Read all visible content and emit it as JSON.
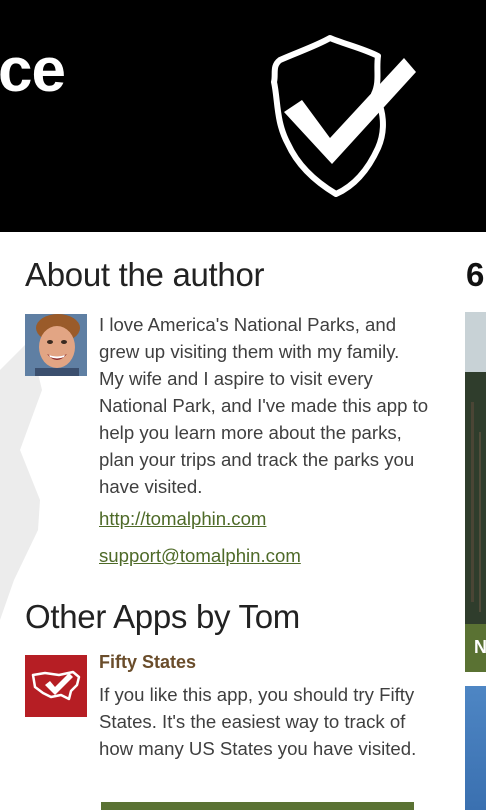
{
  "header": {
    "title_fragment": "ce",
    "logo_icon": "arrowhead-check-icon"
  },
  "about": {
    "title": "About the author",
    "avatar_icon": "author-avatar",
    "bio": "I love America's National Parks, and grew up visiting them with my family. My wife and I aspire to visit every National Park, and I've made this app to help you learn more about the parks, plan your trips and track the parks you have visited.",
    "website": "http://tomalphin.com",
    "email": "support@tomalphin.com"
  },
  "other_apps": {
    "title": "Other Apps by Tom",
    "apps": [
      {
        "name": "Fifty States",
        "description": "If you like this app, you should try Fifty States. It's the easiest way to track of how many US States you have visited.",
        "icon": "usa-map-check-icon"
      }
    ]
  },
  "next_panel": {
    "number_fragment": "6",
    "banner_fragment": "N"
  },
  "colors": {
    "header_bg": "#000000",
    "accent_green": "#5a7233",
    "link_green": "#4e6a28",
    "app_name_brown": "#6a4d2b",
    "app_icon_red": "#b61e24"
  }
}
